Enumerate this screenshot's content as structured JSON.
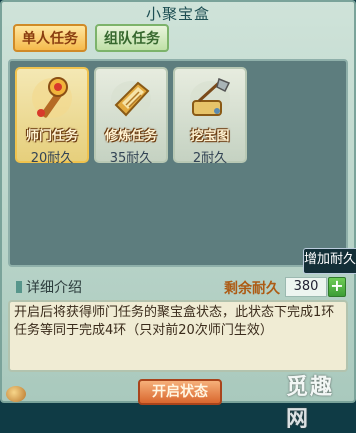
{
  "window": {
    "title": "小聚宝盒"
  },
  "tabs": [
    {
      "label": "单人任务",
      "active": true
    },
    {
      "label": "组队任务",
      "active": false
    }
  ],
  "items": [
    {
      "name": "师门任务",
      "durability": "20耐久",
      "icon": "golden-scepter-icon",
      "selected": true
    },
    {
      "name": "修炼任务",
      "durability": "35耐久",
      "icon": "book-icon",
      "selected": false
    },
    {
      "name": "挖宝图",
      "durability": "2耐久",
      "icon": "shovel-icon",
      "selected": false
    }
  ],
  "side_tab": {
    "label": "增加耐久"
  },
  "detail": {
    "label": "详细介绍",
    "remain_label": "剩余耐久",
    "remain_value": "380",
    "plus_label": "+",
    "description": "开启后将获得师门任务的聚宝盒状态，此状态下完成1环任务等同于完成4环（只对前20次师门生效）"
  },
  "buttons": {
    "open_status": "开启状态"
  },
  "watermark": {
    "text": "觅趣网"
  },
  "colors": {
    "frame": "#cfe3d9",
    "panel": "#5d7d7e",
    "selected_card": "#f0c34e",
    "accent_orange": "#d9672e",
    "plus_green": "#3c9d36"
  }
}
